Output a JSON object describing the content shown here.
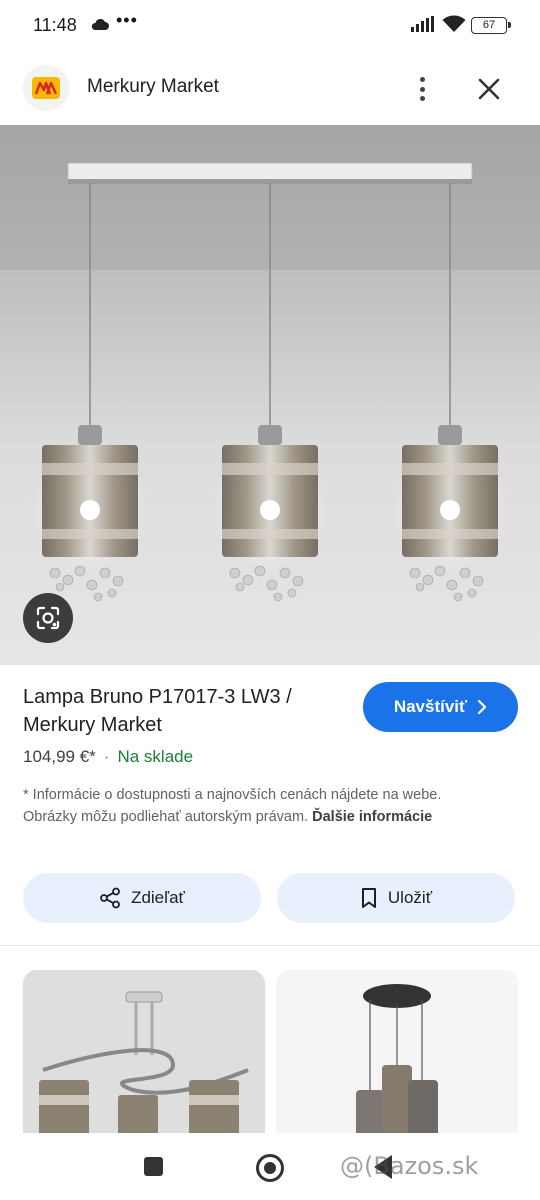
{
  "status_bar": {
    "time": "11:48",
    "dots": "•••",
    "battery": "67"
  },
  "header": {
    "logo_icon": "merkury-market-logo",
    "site_name": "Merkury Market"
  },
  "product": {
    "title": "Lampa Bruno P17017-3 LW3 / Merkury Market",
    "price": "104,99 €*",
    "separator": "·",
    "availability": "Na sklade",
    "visit_label": "Navštíviť",
    "disclaimer": "* Informácie o dostupnosti a najnovších cenách nájdete na webe. Obrázky môžu podliehať autorským právam.",
    "more_label": "Ďalšie informácie"
  },
  "actions": {
    "share_label": "Zdieľať",
    "save_label": "Uložiť"
  },
  "watermark": "@(Bazos.sk",
  "colors": {
    "accent": "#1a73e8",
    "stock_green": "#188038",
    "action_bg": "#e8f0fe"
  }
}
